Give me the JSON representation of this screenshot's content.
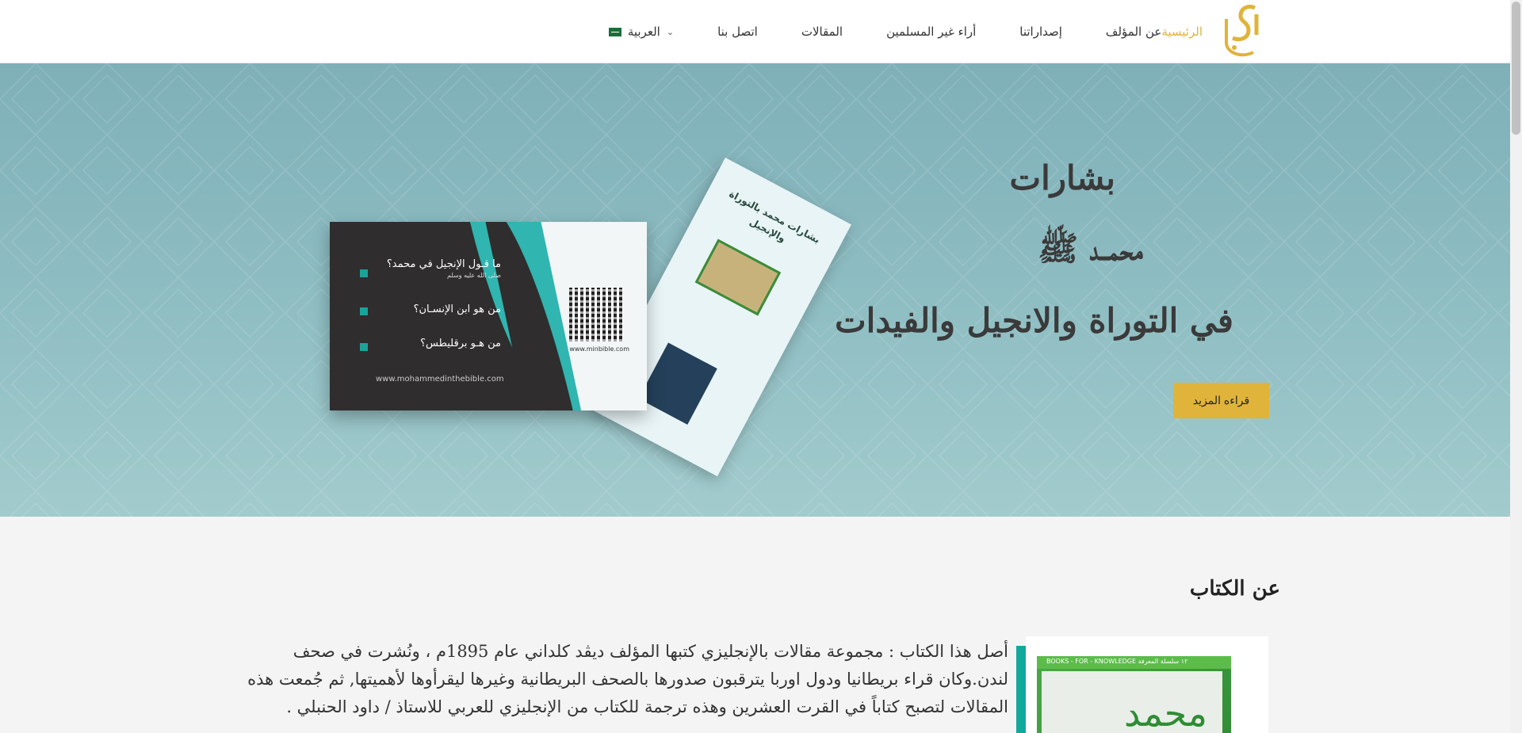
{
  "nav": {
    "items": [
      {
        "label": "الرئيسية",
        "active": true
      },
      {
        "label": "عن المؤلف",
        "active": false
      },
      {
        "label": "إصداراتنا",
        "active": false
      },
      {
        "label": "أراء غير المسلمين",
        "active": false
      },
      {
        "label": "المقالات",
        "active": false
      },
      {
        "label": "اتصل بنا",
        "active": false
      }
    ],
    "language": "العربية"
  },
  "hero": {
    "line1": "بشارات",
    "line2": "محمــد ﷺ",
    "line3": "في التوراة والانجيل والفيدات",
    "button": "قراءه المزيد"
  },
  "flyer": {
    "q1": "ما قـول الإنجيل في محمد؟",
    "q1_sub": "صلى الله عليه وسلم",
    "q2": "من هو ابن الإنسـان؟",
    "q3": "من هـو برقليطس؟",
    "url": "www.mohammedinthebible.com",
    "qr_url": "www.minbible.com"
  },
  "book_card": {
    "title": "بشارات محمد بالتوراة والإنجيل"
  },
  "about": {
    "title": "عن الكتاب",
    "text": "أصل هذا الكتاب :  مجموعة مقالات بالإنجليزي  كتبها المؤلف ديڤد كلداني  عام 1895م ، ونُشرت في صحف لندن.وكان قراء بريطانيا ودول اوربا يترقبون صدورها بالصحف البريطانية وغيرها  ليقرأوها لأهميتها, ثم جُمعت هذه المقالات لتصبح كتاباً  في القرت العشرين وهذه ترجمة للكتاب من الإنجليزي للعربي للاستاذ / داود الحنبلي .",
    "box_label": "BOOKS - FOR - KNOWLEDGE ١٢ سلسلة المعرفة",
    "box_script": "محمد"
  },
  "colors": {
    "accent": "#e0b43a",
    "teal": "#12a99d",
    "hero_bg": "#8fbec3"
  }
}
